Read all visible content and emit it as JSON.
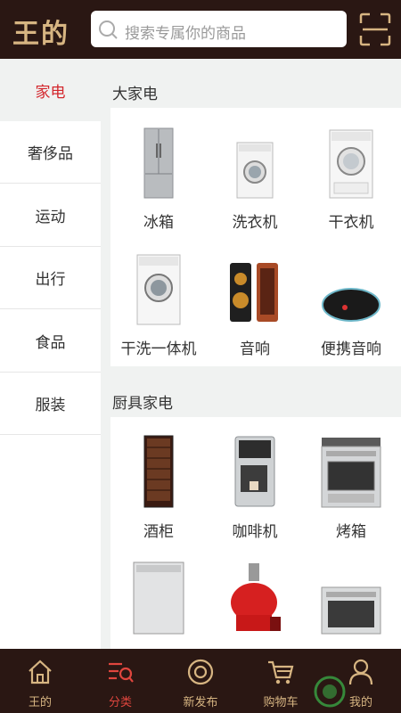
{
  "header": {
    "logo": "王的",
    "search_placeholder": "搜索专属你的商品"
  },
  "sidebar": {
    "items": [
      {
        "label": "家电",
        "active": true
      },
      {
        "label": "奢侈品"
      },
      {
        "label": "运动"
      },
      {
        "label": "出行"
      },
      {
        "label": "食品"
      },
      {
        "label": "服装"
      }
    ]
  },
  "sections": [
    {
      "title": "大家电",
      "products": [
        {
          "name": "冰箱"
        },
        {
          "name": "洗衣机"
        },
        {
          "name": "干衣机"
        },
        {
          "name": "干洗一体机"
        },
        {
          "name": "音响"
        },
        {
          "name": "便携音响"
        }
      ]
    },
    {
      "title": "厨具家电",
      "products": [
        {
          "name": "酒柜"
        },
        {
          "name": "咖啡机"
        },
        {
          "name": "烤箱"
        },
        {
          "name": ""
        },
        {
          "name": ""
        },
        {
          "name": ""
        }
      ]
    }
  ],
  "bottom_nav": [
    {
      "label": "王的",
      "icon": "home-icon"
    },
    {
      "label": "分类",
      "icon": "category-icon",
      "active": true
    },
    {
      "label": "新发布",
      "icon": "new-release-icon"
    },
    {
      "label": "购物车",
      "icon": "cart-icon"
    },
    {
      "label": "我的",
      "icon": "profile-icon"
    }
  ],
  "colors": {
    "header_bg": "#2a1713",
    "gold": "#d7b582",
    "active_red": "#d3262c"
  }
}
